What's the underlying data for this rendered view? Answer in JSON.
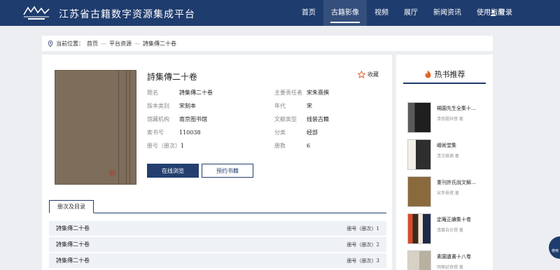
{
  "header": {
    "site_title": "江苏省古籍数字资源集成平台",
    "nav": [
      {
        "label": "首页",
        "active": false
      },
      {
        "label": "古籍影像",
        "active": true
      },
      {
        "label": "视频",
        "active": false
      },
      {
        "label": "展厅",
        "active": false
      },
      {
        "label": "新闻资讯",
        "active": false
      },
      {
        "label": "使用指南",
        "active": false
      }
    ],
    "login_label": "登录"
  },
  "breadcrumb": {
    "prefix": "当前位置：",
    "items": [
      "首页",
      "平台资源",
      "詩集傳二十卷"
    ],
    "separator": "—"
  },
  "book": {
    "title": "詩集傳二十卷",
    "favorite_label": "收藏",
    "fields": [
      {
        "key": "题名",
        "value": "詩集傳二十卷"
      },
      {
        "key": "主要责任者",
        "value": "宋朱熹撰"
      },
      {
        "key": "版本类别",
        "value": "宋刻本"
      },
      {
        "key": "年代",
        "value": "宋"
      },
      {
        "key": "馆藏机构",
        "value": "南京图书馆"
      },
      {
        "key": "文献类型",
        "value": "线装古籍"
      },
      {
        "key": "索书号",
        "value": "110038"
      },
      {
        "key": "分类",
        "value": "经部"
      },
      {
        "key": "册号（册次）",
        "value": "1"
      },
      {
        "key": "册数",
        "value": "6"
      }
    ],
    "read_button": "在线浏览",
    "reserve_button": "预约书籍"
  },
  "volumes": {
    "tab_label": "册次及目录",
    "rows": [
      {
        "title": "詩集傳二十卷",
        "volume": "册号（册次）1"
      },
      {
        "title": "詩集傳二十卷",
        "volume": "册号（册次）2"
      },
      {
        "title": "詩集傳二十卷",
        "volume": "册号（册次）3"
      }
    ]
  },
  "sidebar": {
    "heading": "热书推荐",
    "items": [
      {
        "title": "楊園先生全集十…",
        "author": "清張履祥撰 著",
        "thumb_color": "#2a2a2a"
      },
      {
        "title": "峨術堂集",
        "author": "清沈維鐈 著",
        "thumb_color": "#3a3a3a"
      },
      {
        "title": "重刊許氏說文解…",
        "author": "宋李燾撰 著",
        "thumb_color": "#8a6a3c"
      },
      {
        "title": "定庵正續集十卷",
        "author": "清龔自珍撰 著",
        "thumb_color": "#6b4a2a"
      },
      {
        "title": "素園遺書十八卷",
        "author": "明葉延齊撰 著",
        "thumb_color": "#c9c2b4"
      }
    ]
  },
  "float_button": {
    "label": "使用"
  },
  "colors": {
    "primary": "#1f3c6e",
    "accent": "#e0642e",
    "background": "#eceef1"
  }
}
